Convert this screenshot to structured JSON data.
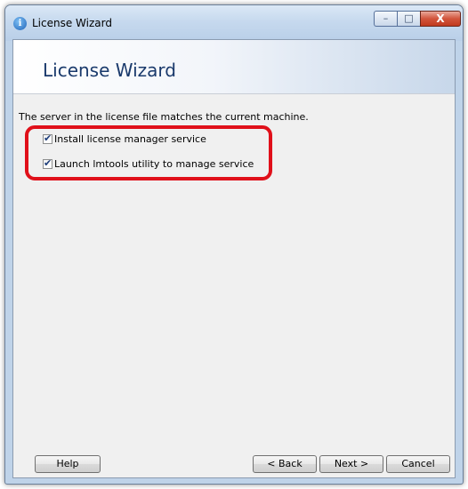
{
  "window": {
    "title": "License Wizard",
    "minimize_glyph": "–",
    "maximize_glyph": "□",
    "close_glyph": "X"
  },
  "banner": {
    "title": "License Wizard"
  },
  "content": {
    "status_text": "The server in the license file matches the current machine.",
    "options": [
      {
        "label": "Install license manager service",
        "checked": true
      },
      {
        "label": "Launch lmtools utility to manage service",
        "checked": true
      }
    ]
  },
  "buttons": {
    "help": "Help",
    "back": "< Back",
    "next": "Next >",
    "cancel": "Cancel"
  },
  "colors": {
    "highlight": "#e0101a",
    "banner_title": "#1a3a6c",
    "close_button": "#c03a1f"
  },
  "icons": {
    "app": "info-icon",
    "check": "✔"
  }
}
